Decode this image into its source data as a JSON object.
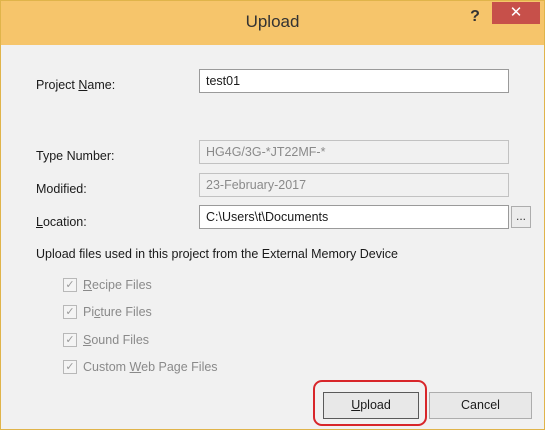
{
  "window": {
    "title": "Upload",
    "help_label": "?",
    "close_label": "✕"
  },
  "form": {
    "project_name": {
      "label_pre": "Project ",
      "label_mn": "N",
      "label_post": "ame:",
      "value": "test01"
    },
    "type_number": {
      "label": "Type Number:",
      "value": "HG4G/3G-*JT22MF-*"
    },
    "modified": {
      "label": "Modified:",
      "value": "23-February-2017"
    },
    "location": {
      "label_mn": "L",
      "label_post": "ocation:",
      "value": "C:\\Users\\t\\Documents",
      "browse_label": "..."
    }
  },
  "upload_section": {
    "label": "Upload files used in this project from the External Memory Device",
    "options": [
      {
        "pre": "",
        "mn": "R",
        "post": "ecipe Files",
        "checked": true,
        "enabled": false
      },
      {
        "pre": "Pi",
        "mn": "c",
        "post": "ture Files",
        "checked": true,
        "enabled": false
      },
      {
        "pre": "",
        "mn": "S",
        "post": "ound Files",
        "checked": true,
        "enabled": false
      },
      {
        "pre": "Custom ",
        "mn": "W",
        "post": "eb Page Files",
        "checked": true,
        "enabled": false
      }
    ],
    "check_glyph": "✓"
  },
  "buttons": {
    "upload": {
      "mn": "U",
      "post": "pload"
    },
    "cancel": "Cancel"
  },
  "colors": {
    "titlebar": "#f6c56b",
    "close_button": "#c7504a",
    "highlight": "#d8262a"
  }
}
